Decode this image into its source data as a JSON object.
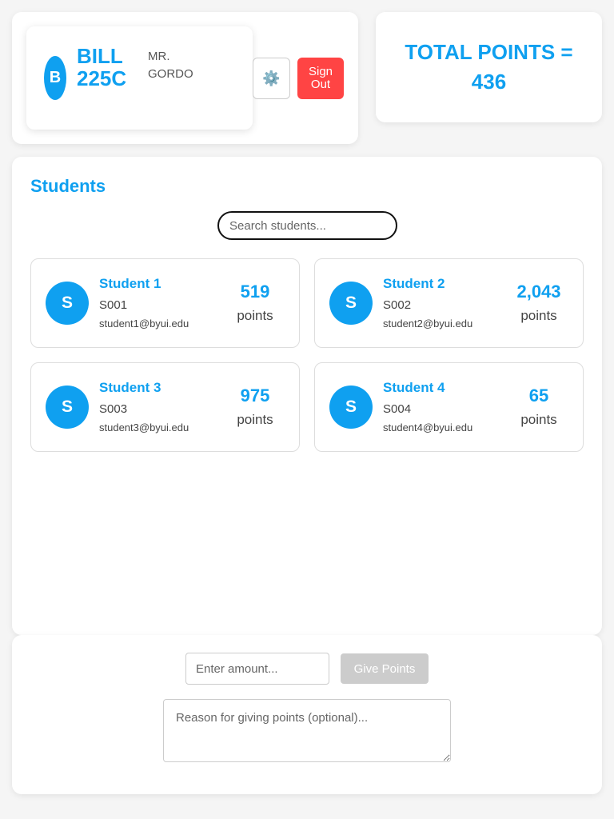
{
  "profile": {
    "avatar_letter": "B",
    "class_name": "BILL 225C",
    "teacher": "MR. GORDO",
    "settings_icon": "⚙️",
    "signout_label": "Sign Out"
  },
  "total": {
    "label": "TOTAL POINTS =",
    "value": "436"
  },
  "students_section": {
    "title": "Students",
    "search_placeholder": "Search students...",
    "students": [
      {
        "avatar": "S",
        "name": "Student 1",
        "id": "S001",
        "email": "student1@byui.edu",
        "points": "519",
        "points_label": "points"
      },
      {
        "avatar": "S",
        "name": "Student 2",
        "id": "S002",
        "email": "student2@byui.edu",
        "points": "2,043",
        "points_label": "points"
      },
      {
        "avatar": "S",
        "name": "Student 3",
        "id": "S003",
        "email": "student3@byui.edu",
        "points": "975",
        "points_label": "points"
      },
      {
        "avatar": "S",
        "name": "Student 4",
        "id": "S004",
        "email": "student4@byui.edu",
        "points": "65",
        "points_label": "points"
      }
    ]
  },
  "give_points": {
    "amount_placeholder": "Enter amount...",
    "button_label": "Give Points",
    "reason_placeholder": "Reason for giving points (optional)..."
  },
  "colors": {
    "accent": "#0fa0f0",
    "danger": "#ff4444",
    "disabled": "#cccccc"
  }
}
